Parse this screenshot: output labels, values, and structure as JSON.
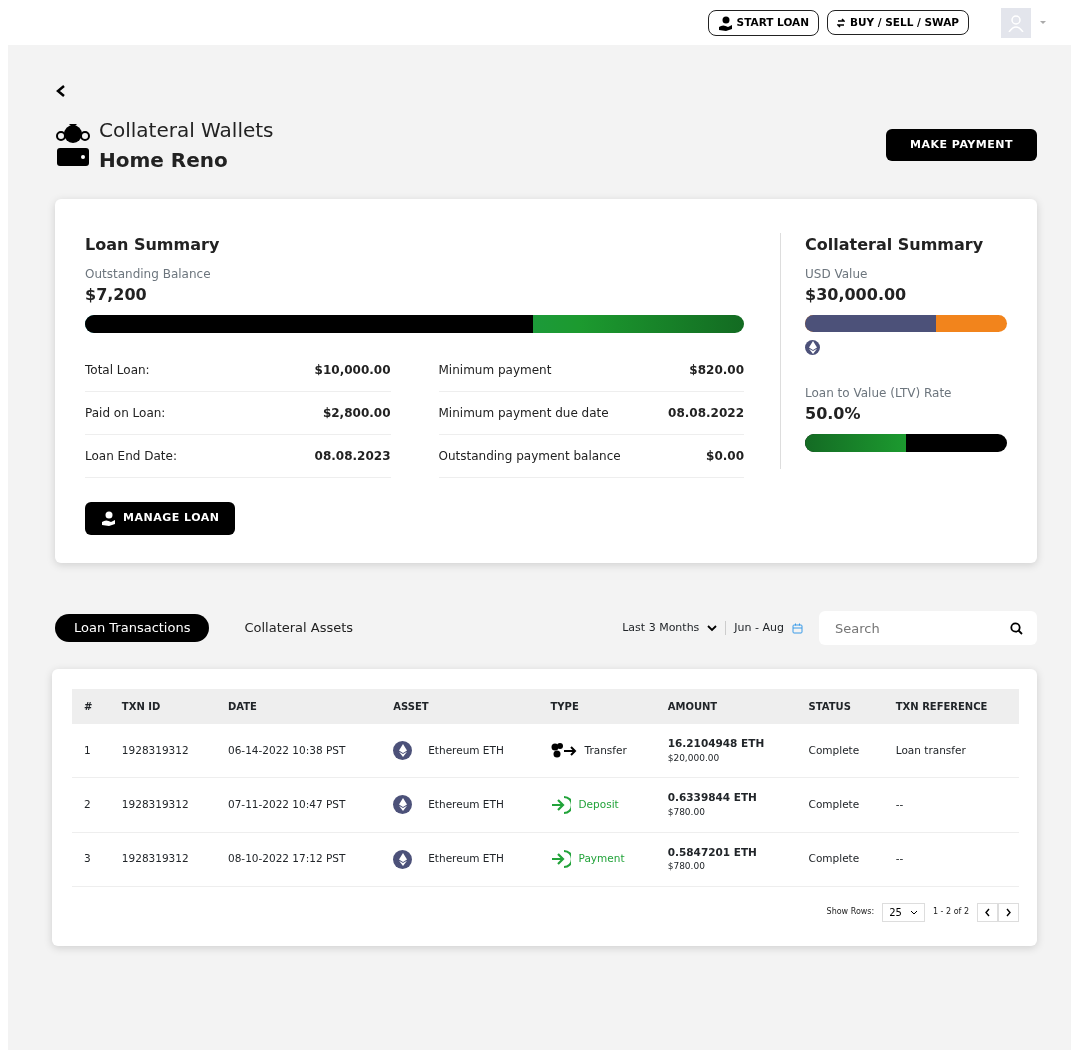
{
  "header": {
    "buttons": [
      {
        "kind": "loan",
        "label": "START LOAN"
      },
      {
        "kind": "swap",
        "label": "BUY / SELL / SWAP"
      }
    ]
  },
  "page": {
    "title": "Collateral Wallets",
    "subtitle": "Home Reno",
    "action": "MAKE PAYMENT"
  },
  "loan_summary": {
    "title": "Loan Summary",
    "balance_label": "Outstanding Balance",
    "balance": "$7,200",
    "level": 0.68,
    "details_left": [
      {
        "label": "Total Loan:",
        "value": "$10,000.00"
      },
      {
        "label": "Paid on Loan:",
        "value": "$2,800.00"
      },
      {
        "label": "Loan End Date:",
        "value": "08.08.2023"
      }
    ],
    "details_right": [
      {
        "label": "Minimum payment",
        "value": "$820.00"
      },
      {
        "label": "Minimum payment due date",
        "value": "08.08.2022"
      },
      {
        "label": "Outstanding payment balance",
        "value": "$0.00"
      }
    ],
    "button": "MANAGE LOAN"
  },
  "collateral_summary": {
    "title": "Collateral Summary",
    "usd_label": "USD Value",
    "usd_value": "$30,000.00",
    "usd_bar": {
      "level": 0.65
    },
    "ltv_label": "Loan to Value (LTV) Rate",
    "ltv_value": "50.0%",
    "ltv_bar": {
      "level": 0.5
    }
  },
  "tabs": [
    {
      "label": "Loan Transactions",
      "selected": true
    },
    {
      "label": "Collateral Assets",
      "selected": false
    }
  ],
  "filters": {
    "range": "Last 3 Months",
    "dates": "Jun - Aug",
    "search_placeholder": "Search"
  },
  "table": {
    "columns": [
      "#",
      "TXN ID",
      "DATE",
      "ASSET",
      "TYPE",
      "AMOUNT",
      "STATUS",
      "TXN REFERENCE"
    ],
    "rows": [
      {
        "num": "1",
        "txn_id": "1928319312",
        "date": "06-14-2022 10:38 PST",
        "asset": "Ethereum ETH",
        "kind": "transfer",
        "type": "Transfer",
        "amount": "16.2104948 ETH",
        "usd": "$20,000.00",
        "status": "Complete",
        "reference": "Loan transfer"
      },
      {
        "num": "2",
        "txn_id": "1928319312",
        "date": "07-11-2022 10:47 PST",
        "asset": "Ethereum ETH",
        "kind": "incoming",
        "type": "Deposit",
        "amount": "0.6339844 ETH",
        "usd": "$780.00",
        "status": "Complete",
        "reference": "--"
      },
      {
        "num": "3",
        "txn_id": "1928319312",
        "date": "08-10-2022 17:12 PST",
        "asset": "Ethereum ETH",
        "kind": "incoming",
        "type": "Payment",
        "amount": "0.5847201 ETH",
        "usd": "$780.00",
        "status": "Complete",
        "reference": "--"
      }
    ]
  },
  "pagination": {
    "rows_label": "Show Rows:",
    "rows_value": "25",
    "range": "1 - 2 of 2"
  }
}
